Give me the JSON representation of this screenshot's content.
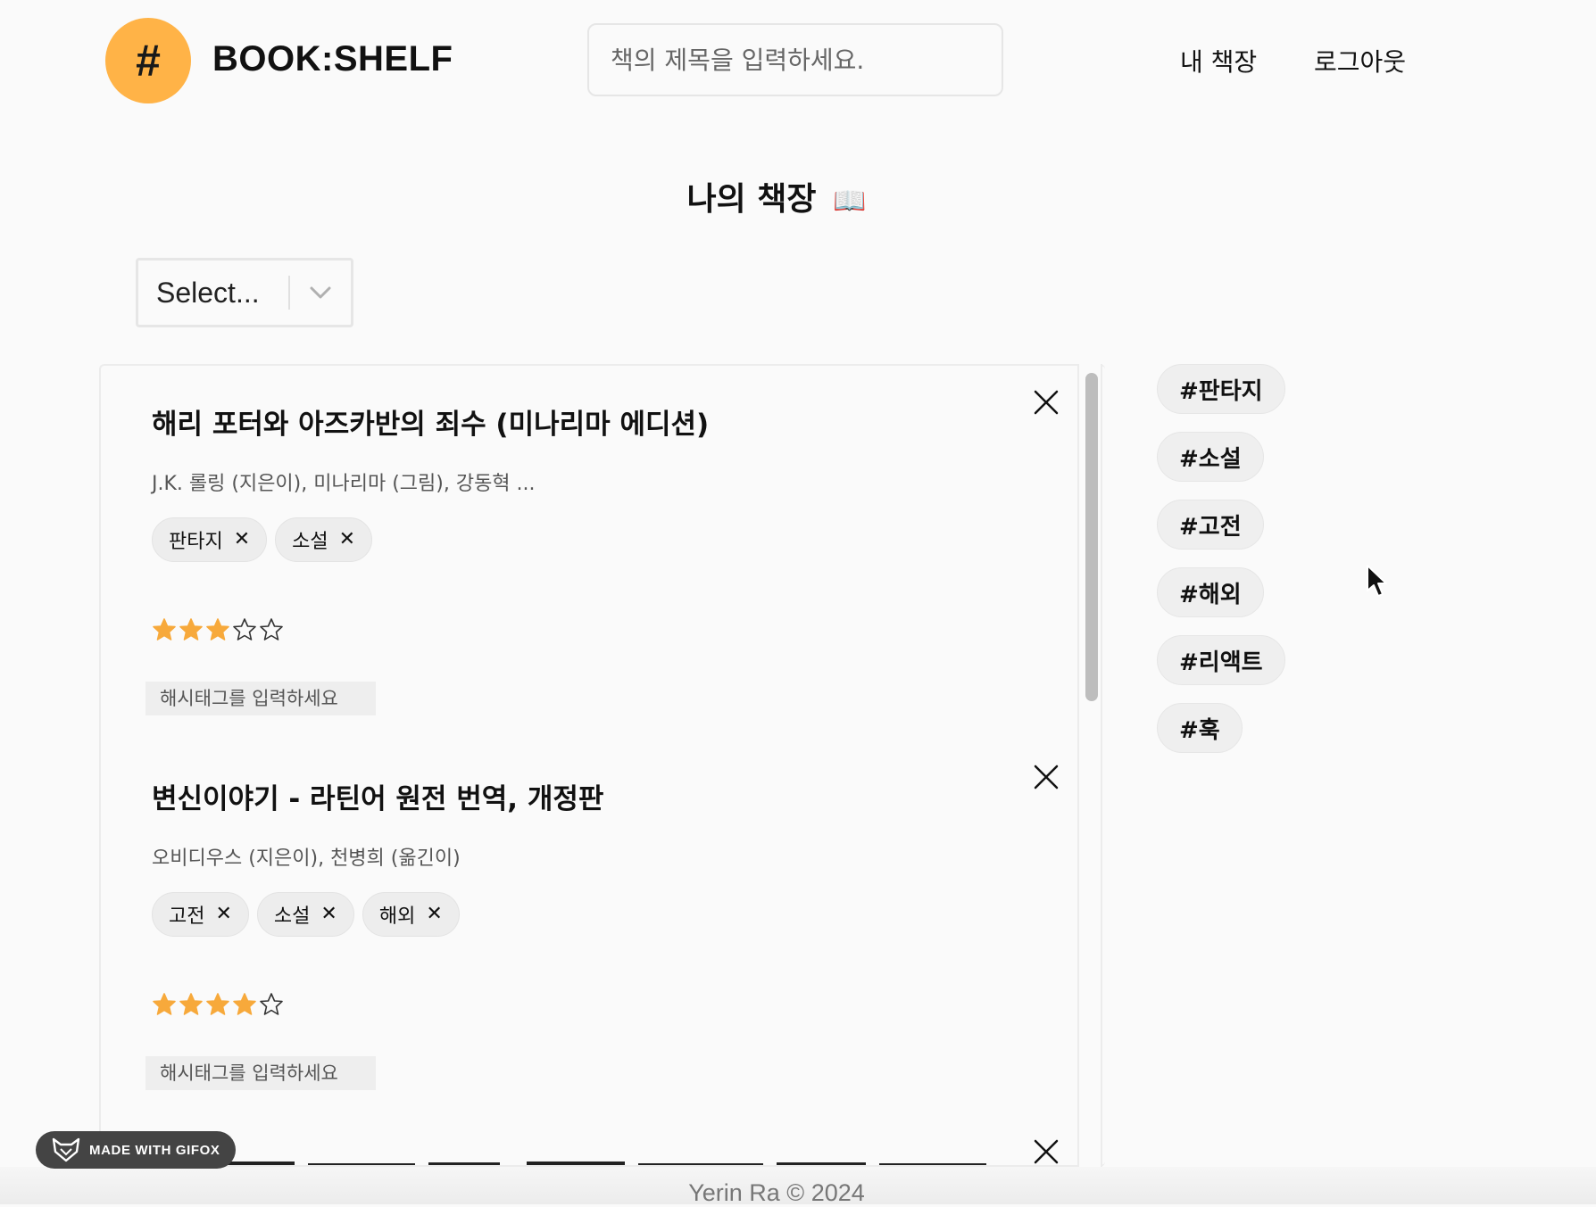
{
  "header": {
    "logo_symbol": "#",
    "brand": "BOOK:SHELF",
    "search_placeholder": "책의 제목을 입력하세요.",
    "nav": [
      "내 책장",
      "로그아웃"
    ]
  },
  "page_title": "나의 책장",
  "page_title_icon": "📖",
  "select": {
    "value": "Select..."
  },
  "books": [
    {
      "title": "해리 포터와 아즈카반의 죄수 (미나리마 에디션)",
      "authors": "J.K. 롤링 (지은이), 미나리마 (그림), 강동혁 ...",
      "tags": [
        "판타지",
        "소설"
      ],
      "rating": 3,
      "rating_max": 5,
      "hashtag_placeholder": "해시태그를 입력하세요"
    },
    {
      "title": "변신이야기 - 라틴어 원전 번역, 개정판",
      "authors": "오비디우스 (지은이), 천병희 (옮긴이)",
      "tags": [
        "고전",
        "소설",
        "해외"
      ],
      "rating": 4,
      "rating_max": 5,
      "hashtag_placeholder": "해시태그를 입력하세요"
    }
  ],
  "hashtags": [
    "#판타지",
    "#소설",
    "#고전",
    "#해외",
    "#리액트",
    "#훅"
  ],
  "footer": "Yerin Ra © 2024",
  "watermark": "MADE WITH GIFOX",
  "colors": {
    "accent": "#ffb347",
    "star_filled": "#f7a93b",
    "star_empty_stroke": "#333333"
  }
}
